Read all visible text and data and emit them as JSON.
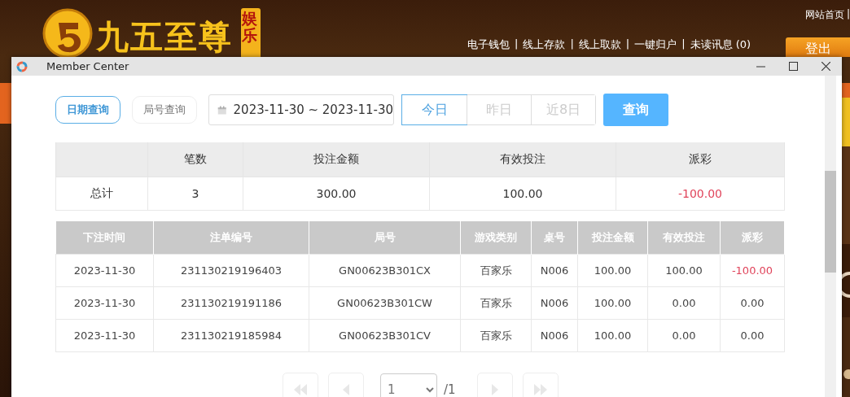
{
  "site": {
    "logo_text": "九五至尊",
    "logo_badge": "娱乐",
    "top_link": "网站首页",
    "separator": "|",
    "nav": [
      "电子钱包",
      "线上存款",
      "线上取款",
      "一键归户",
      "未读讯息 (0)"
    ],
    "logout": "登出"
  },
  "window": {
    "title": "Member Center"
  },
  "query_tabs": [
    {
      "label": "日期查询",
      "selected": true
    },
    {
      "label": "局号查询",
      "selected": false
    }
  ],
  "date_range": {
    "value": "2023-11-30 ~ 2023-11-30"
  },
  "quick_ranges": [
    {
      "label": "今日",
      "selected": true
    },
    {
      "label": "昨日",
      "selected": false
    },
    {
      "label": "近8日",
      "selected": false
    }
  ],
  "query_button": "查询",
  "summary": {
    "columns": [
      "笔数",
      "投注金额",
      "有效投注",
      "派彩"
    ],
    "row_label": "总计",
    "cells": [
      {
        "text": "3",
        "negative": false
      },
      {
        "text": "300.00",
        "negative": false
      },
      {
        "text": "100.00",
        "negative": false
      },
      {
        "text": "-100.00",
        "negative": true
      }
    ]
  },
  "bets": {
    "columns": [
      "下注时间",
      "注单编号",
      "局号",
      "游戏类别",
      "桌号",
      "投注金额",
      "有效投注",
      "派彩"
    ],
    "rows": [
      {
        "cells": [
          "2023-11-30",
          "231130219196403",
          "GN00623B301CX",
          "百家乐",
          "N006",
          "100.00",
          "100.00",
          "-100.00"
        ],
        "payout_negative": true
      },
      {
        "cells": [
          "2023-11-30",
          "231130219191186",
          "GN00623B301CW",
          "百家乐",
          "N006",
          "100.00",
          "0.00",
          "0.00"
        ],
        "payout_negative": false
      },
      {
        "cells": [
          "2023-11-30",
          "231130219185984",
          "GN00623B301CV",
          "百家乐",
          "N006",
          "100.00",
          "0.00",
          "0.00"
        ],
        "payout_negative": false
      }
    ]
  },
  "pager": {
    "page": "1",
    "total": "/1",
    "disabled": true
  }
}
